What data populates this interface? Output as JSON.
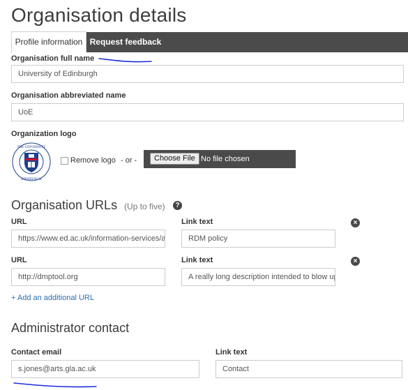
{
  "page": {
    "title": "Organisation details"
  },
  "tabs": [
    {
      "label": "Profile information",
      "active": true
    },
    {
      "label": "Request feedback",
      "active": false
    }
  ],
  "org_full_name": {
    "label": "Organisation full name",
    "value": "University of Edinburgh"
  },
  "org_abbrev_name": {
    "label": "Organisation abbreviated name",
    "value": "UoE"
  },
  "logo": {
    "label": "Organization logo",
    "remove_label": "Remove logo",
    "or_text": "- or -",
    "choose_file_label": "Choose File",
    "file_status": "No file chosen",
    "logo_ring_text": "THE UNIVERSITY of EDINBURGH"
  },
  "urls": {
    "title": "Organisation URLs",
    "hint": "(Up to five)",
    "help_glyph": "?",
    "rows": [
      {
        "url_label": "URL",
        "url_value": "https://www.ed.ac.uk/information-services/a",
        "link_label": "Link text",
        "link_value": "RDM policy"
      },
      {
        "url_label": "URL",
        "url_value": "http://dmptool.org",
        "link_label": "Link text",
        "link_value": "A really long description intended to blow up"
      }
    ],
    "add_link": "+ Add an additional URL"
  },
  "admin": {
    "title": "Administrator contact",
    "email_label": "Contact email",
    "email_value": "s.jones@arts.gla.ac.uk",
    "link_label": "Link text",
    "link_value": "Contact"
  },
  "colors": {
    "tab_bar": "#4b4b4b",
    "link": "#2a6db4",
    "annotation_pen": "#1d2fd6",
    "logo_red": "#c8102e",
    "logo_blue": "#1d3f8f"
  }
}
